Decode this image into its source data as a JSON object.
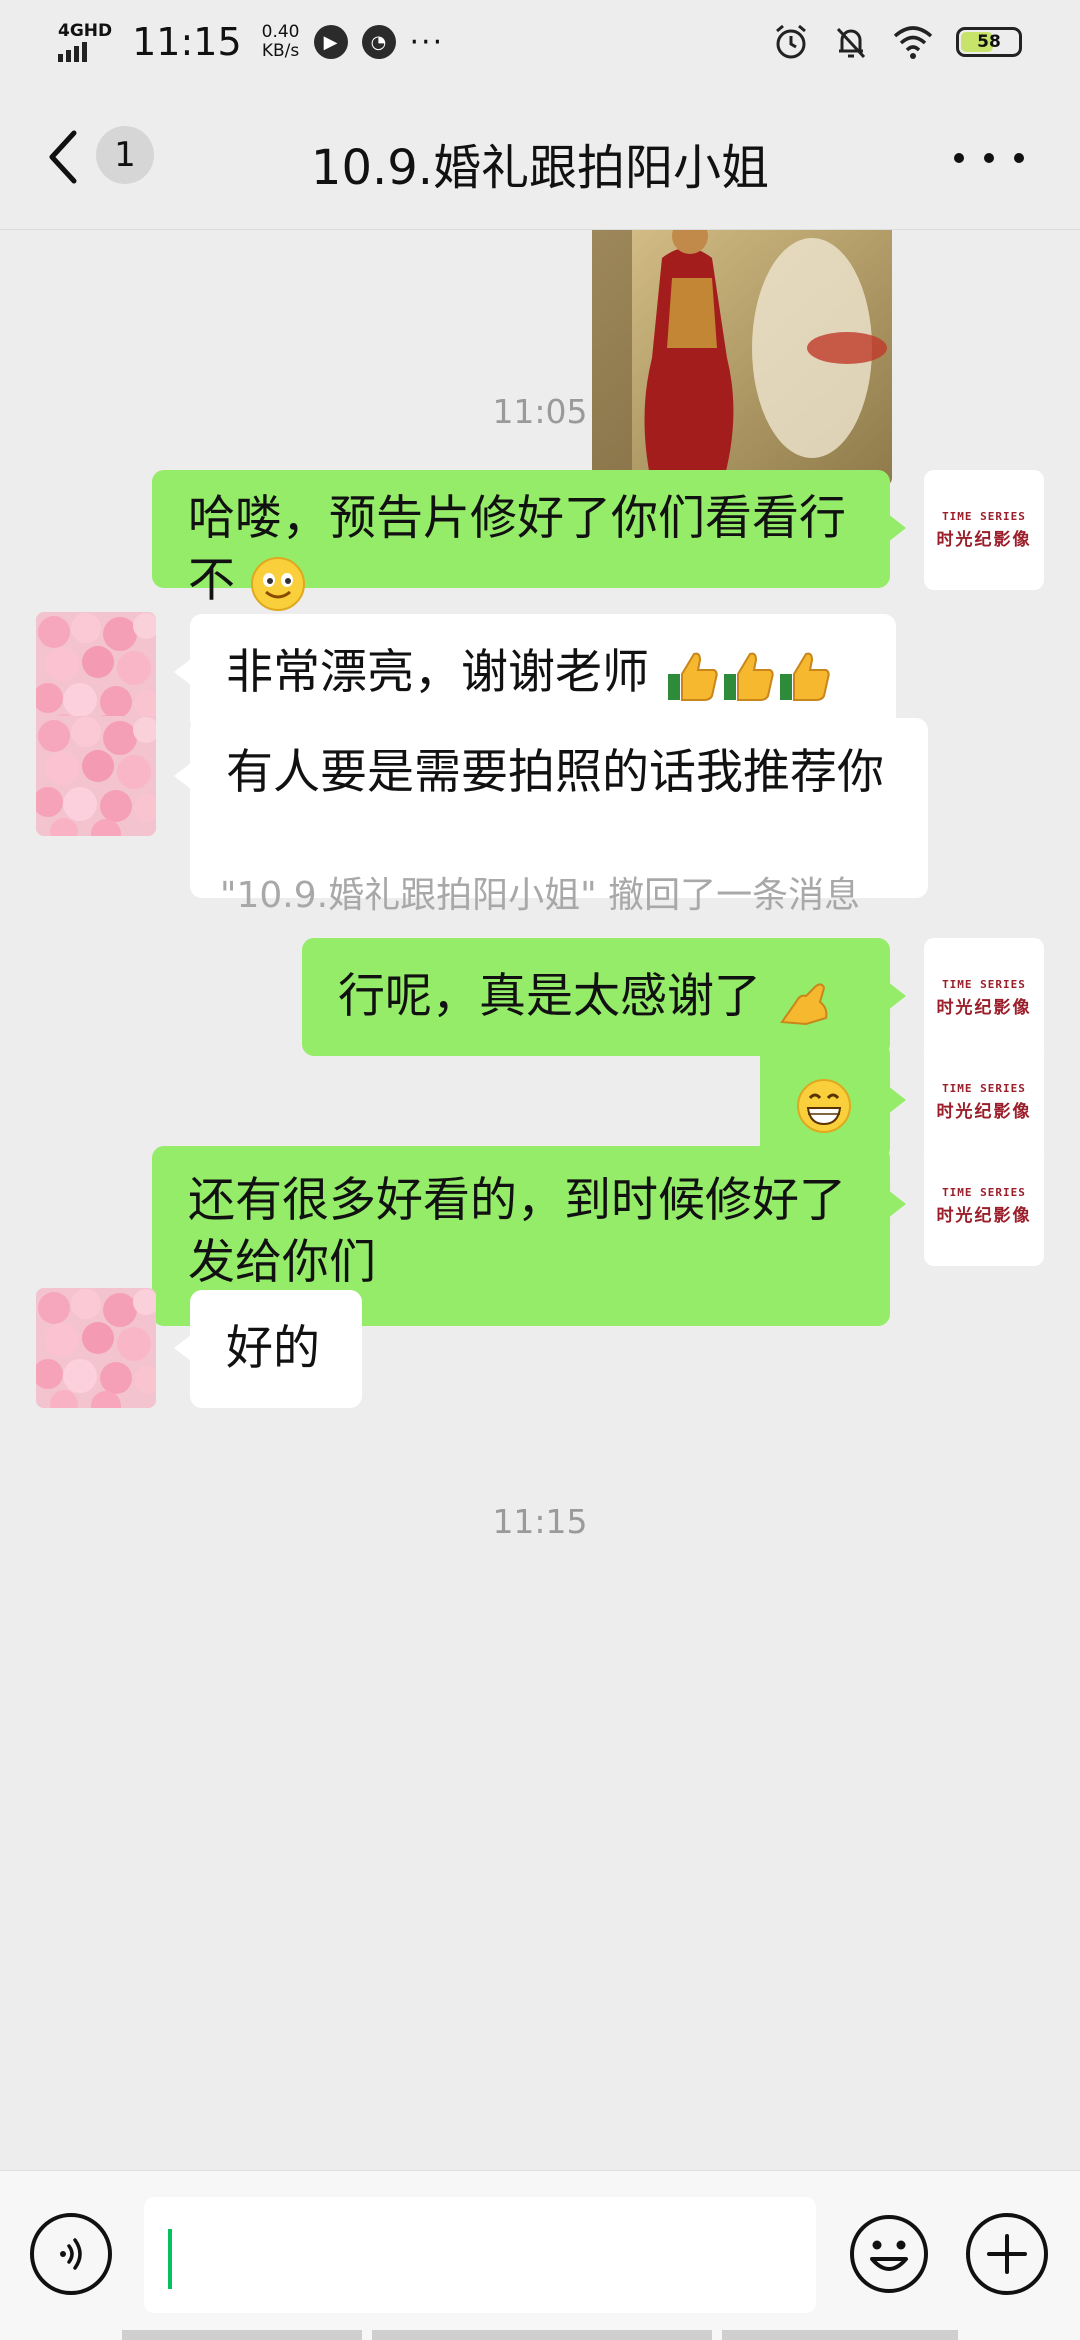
{
  "status_bar": {
    "network": "4GHD",
    "time": "11:15",
    "speed_value": "0.40",
    "speed_unit": "KB/s",
    "more": "···",
    "battery": "58"
  },
  "header": {
    "back_count": "1",
    "title": "10.9.婚礼跟拍阳小姐"
  },
  "logo_avatar": {
    "top_text": "TIME SERIES",
    "main_text": "时光纪影像"
  },
  "messages": {
    "time_1": "11:05",
    "out_1": "哈喽，预告片修好了你们看看行不",
    "in_1": "非常漂亮，谢谢老师",
    "in_2": "有人要是需要拍照的话我推荐你",
    "recall_notice": "\"10.9.婚礼跟拍阳小姐\" 撤回了一条消息",
    "out_2": "行呢，真是太感谢了",
    "out_4": "还有很多好看的，到时候修好了发给你们",
    "in_3": "好的",
    "time_2": "11:15"
  },
  "icons": {
    "back": "chevron-left-icon",
    "more": "more-dots-icon",
    "voice": "voice-icon",
    "emoji": "emoji-icon",
    "plus": "plus-icon"
  },
  "colors": {
    "outgoing_bubble": "#95ec69",
    "incoming_bubble": "#ffffff",
    "background": "#ededed",
    "cursor": "#07c160",
    "logo": "#9b1f2b"
  }
}
